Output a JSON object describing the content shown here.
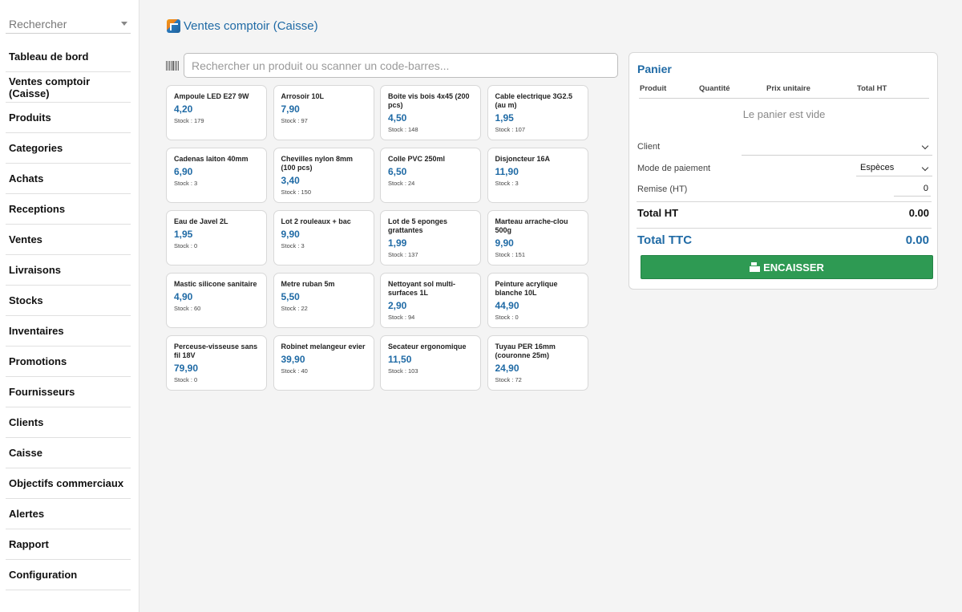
{
  "sidebar": {
    "search_placeholder": "Rechercher",
    "items": [
      {
        "label": "Tableau de bord"
      },
      {
        "label": "Ventes comptoir (Caisse)"
      },
      {
        "label": "Produits"
      },
      {
        "label": "Categories"
      },
      {
        "label": "Achats"
      },
      {
        "label": "Receptions"
      },
      {
        "label": "Ventes"
      },
      {
        "label": "Livraisons"
      },
      {
        "label": "Stocks"
      },
      {
        "label": "Inventaires"
      },
      {
        "label": "Promotions"
      },
      {
        "label": "Fournisseurs"
      },
      {
        "label": "Clients"
      },
      {
        "label": "Caisse"
      },
      {
        "label": "Objectifs commerciaux"
      },
      {
        "label": "Alertes"
      },
      {
        "label": "Rapport"
      },
      {
        "label": "Configuration"
      }
    ]
  },
  "header": {
    "title": "Ventes comptoir (Caisse)"
  },
  "search": {
    "placeholder": "Rechercher un produit ou scanner un code-barres..."
  },
  "products": [
    {
      "name": "Ampoule LED E27 9W",
      "price": "4,20",
      "stock": "Stock : 179"
    },
    {
      "name": "Arrosoir 10L",
      "price": "7,90",
      "stock": "Stock : 97"
    },
    {
      "name": "Boite vis bois 4x45 (200 pcs)",
      "price": "4,50",
      "stock": "Stock : 148"
    },
    {
      "name": "Cable electrique 3G2.5 (au m)",
      "price": "1,95",
      "stock": "Stock : 107"
    },
    {
      "name": "Cadenas laiton 40mm",
      "price": "6,90",
      "stock": "Stock : 3"
    },
    {
      "name": "Chevilles nylon 8mm (100 pcs)",
      "price": "3,40",
      "stock": "Stock : 150"
    },
    {
      "name": "Colle PVC 250ml",
      "price": "6,50",
      "stock": "Stock : 24"
    },
    {
      "name": "Disjoncteur 16A",
      "price": "11,90",
      "stock": "Stock : 3"
    },
    {
      "name": "Eau de Javel 2L",
      "price": "1,95",
      "stock": "Stock : 0"
    },
    {
      "name": "Lot 2 rouleaux + bac",
      "price": "9,90",
      "stock": "Stock : 3"
    },
    {
      "name": "Lot de 5 eponges grattantes",
      "price": "1,99",
      "stock": "Stock : 137"
    },
    {
      "name": "Marteau arrache-clou 500g",
      "price": "9,90",
      "stock": "Stock : 151"
    },
    {
      "name": "Mastic silicone sanitaire",
      "price": "4,90",
      "stock": "Stock : 60"
    },
    {
      "name": "Metre ruban 5m",
      "price": "5,50",
      "stock": "Stock : 22"
    },
    {
      "name": "Nettoyant sol multi-surfaces 1L",
      "price": "2,90",
      "stock": "Stock : 94"
    },
    {
      "name": "Peinture acrylique blanche 10L",
      "price": "44,90",
      "stock": "Stock : 0"
    },
    {
      "name": "Perceuse-visseuse sans fil 18V",
      "price": "79,90",
      "stock": "Stock : 0"
    },
    {
      "name": "Robinet melangeur evier",
      "price": "39,90",
      "stock": "Stock : 40"
    },
    {
      "name": "Secateur ergonomique",
      "price": "11,50",
      "stock": "Stock : 103"
    },
    {
      "name": "Tuyau PER 16mm (couronne 25m)",
      "price": "24,90",
      "stock": "Stock : 72"
    }
  ],
  "cart": {
    "title": "Panier",
    "columns": [
      "Produit",
      "Quantité",
      "Prix unitaire",
      "Total HT"
    ],
    "empty_text": "Le panier est vide",
    "client_label": "Client",
    "client_value": "",
    "payment_label": "Mode de paiement",
    "payment_value": "Espèces",
    "discount_label": "Remise (HT)",
    "discount_value": "0",
    "total_ht_label": "Total HT",
    "total_ht_value": "0.00",
    "total_ttc_label": "Total TTC",
    "total_ttc_value": "0.00",
    "checkout_label": "ENCAISSER"
  },
  "colors": {
    "accent": "#1f6aa5",
    "checkout_green": "#2e9a53"
  }
}
